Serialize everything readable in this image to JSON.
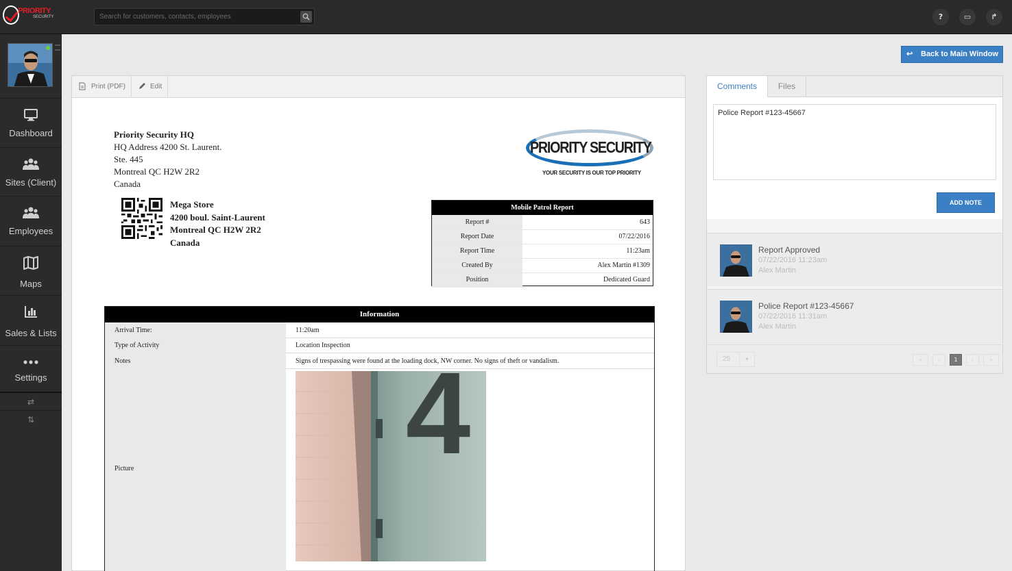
{
  "app": {
    "logo": {
      "name": "PRIORITY",
      "sub": "SECURITY"
    },
    "search": {
      "placeholder": "Search for customers, contacts, employees"
    },
    "topbar_icons": [
      {
        "name": "help-icon",
        "glyph": "?"
      },
      {
        "name": "monitor-icon",
        "glyph": "▭"
      },
      {
        "name": "share-icon",
        "glyph": "↱"
      }
    ]
  },
  "sidebar": {
    "items": [
      {
        "label": "Dashboard",
        "icon": "monitor-icon"
      },
      {
        "label": "Sites (Client)",
        "icon": "users-icon"
      },
      {
        "label": "Employees",
        "icon": "users-icon"
      },
      {
        "label": "Maps",
        "icon": "map-icon"
      },
      {
        "label": "Sales & Lists",
        "icon": "bar-chart-icon"
      },
      {
        "label": "Settings",
        "icon": "dots-icon"
      }
    ],
    "bottom": [
      {
        "glyph": "⇄",
        "icon": "swap-horizontal-icon"
      },
      {
        "glyph": "⇅",
        "icon": "swap-vertical-icon"
      }
    ]
  },
  "header": {
    "back_label": "Back to Main Window",
    "back_icon": "↩"
  },
  "report_toolbar": {
    "print_label": "Print (PDF)",
    "edit_label": "Edit"
  },
  "report": {
    "hq": {
      "title": "Priority Security HQ",
      "lines": [
        "HQ Address 4200 St. Laurent.",
        "Ste. 445",
        "Montreal QC H2W 2R2",
        "Canada"
      ]
    },
    "client": {
      "lines": [
        "Mega Store",
        "4200 boul. Saint-Laurent",
        "Montreal QC H2W 2R2",
        "Canada"
      ]
    },
    "logo": {
      "brand": "PRIORITY SECURITY",
      "tagline": "YOUR SECURITY IS OUR TOP PRIORITY"
    },
    "mobile_patrol": {
      "title": "Mobile Patrol Report",
      "rows": [
        {
          "label": "Report #",
          "value": "643"
        },
        {
          "label": "Report Date",
          "value": "07/22/2016"
        },
        {
          "label": "Report Time",
          "value": "11:23am"
        },
        {
          "label": "Created By",
          "value": "Alex Martin #1309"
        },
        {
          "label": "Position",
          "value": "Dedicated Guard"
        }
      ]
    },
    "information": {
      "title": "Information",
      "rows": [
        {
          "label": "Arrival Time:",
          "value": "11:20am"
        },
        {
          "label": "Type of Activity",
          "value": "Location Inspection"
        },
        {
          "label": "Notes",
          "value": "Signs of trespassing were found at the loading dock, NW corner. No signs of theft or vandalism."
        }
      ],
      "picture_label": "Picture",
      "picture_number": "4"
    }
  },
  "right_panel": {
    "tabs": [
      "Comments",
      "Files"
    ],
    "note_text": "Police Report #123-45667",
    "add_note_label": "ADD NOTE",
    "feed": [
      {
        "title": "Report Approved",
        "date": "07/22/2016 11:23am",
        "author": "Alex Martin"
      },
      {
        "title": "Police Report #123-45667",
        "date": "07/22/2016 11:31am",
        "author": "Alex Martin"
      }
    ],
    "pager": {
      "page_size": "25",
      "current_page": "1",
      "first": "«",
      "prev": "‹",
      "next": "›",
      "last": "»"
    }
  },
  "colors": {
    "accent": "#3b7fc4",
    "topbar": "#2a2a2a",
    "sidebar": "#2b2b2b",
    "brand_red": "#e31e24"
  }
}
